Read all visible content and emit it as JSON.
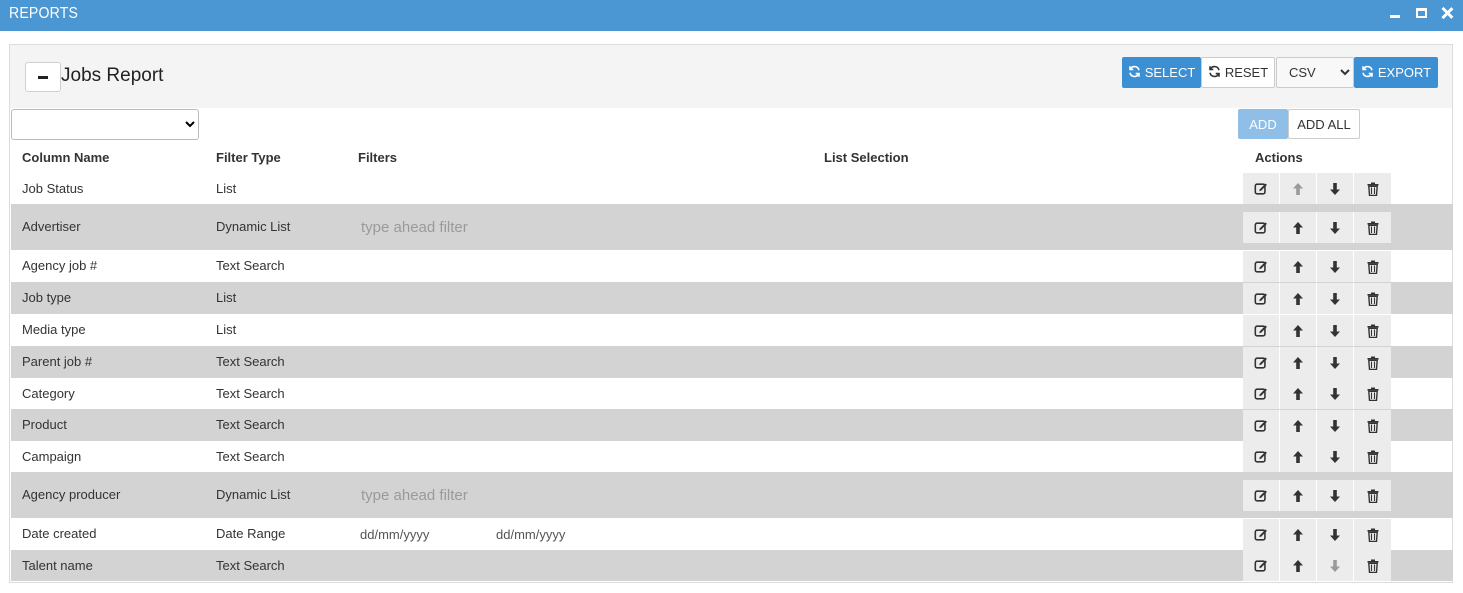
{
  "window": {
    "title": "REPORTS"
  },
  "report": {
    "title": "Jobs Report"
  },
  "toolbar": {
    "select_label": "SELECT",
    "reset_label": "RESET",
    "format_selected": "CSV",
    "format_options": [
      "CSV"
    ],
    "export_label": "EXPORT"
  },
  "columns_picker": {
    "selected": "",
    "add_label": "ADD",
    "add_all_label": "ADD ALL"
  },
  "table": {
    "headers": {
      "column_name": "Column Name",
      "filter_type": "Filter Type",
      "filters": "Filters",
      "list_selection": "List Selection",
      "actions": "Actions"
    },
    "rows": [
      {
        "column": "Job Status",
        "type": "List",
        "filter": "",
        "up_disabled": true,
        "down_disabled": false
      },
      {
        "column": "Advertiser",
        "type": "Dynamic List",
        "filter": "typeahead",
        "placeholder": "type ahead filter",
        "up_disabled": false,
        "down_disabled": false
      },
      {
        "column": "Agency job #",
        "type": "Text Search",
        "filter": "",
        "up_disabled": false,
        "down_disabled": false
      },
      {
        "column": "Job type",
        "type": "List",
        "filter": "",
        "up_disabled": false,
        "down_disabled": false
      },
      {
        "column": "Media type",
        "type": "List",
        "filter": "",
        "up_disabled": false,
        "down_disabled": false
      },
      {
        "column": "Parent job #",
        "type": "Text Search",
        "filter": "",
        "up_disabled": false,
        "down_disabled": false
      },
      {
        "column": "Category",
        "type": "Text Search",
        "filter": "",
        "up_disabled": false,
        "down_disabled": false
      },
      {
        "column": "Product",
        "type": "Text Search",
        "filter": "",
        "up_disabled": false,
        "down_disabled": false
      },
      {
        "column": "Campaign",
        "type": "Text Search",
        "filter": "",
        "up_disabled": false,
        "down_disabled": false
      },
      {
        "column": "Agency producer",
        "type": "Dynamic List",
        "filter": "typeahead",
        "placeholder": "type ahead filter",
        "up_disabled": false,
        "down_disabled": false
      },
      {
        "column": "Date created",
        "type": "Date Range",
        "filter": "daterange",
        "date_from_placeholder": "dd/mm/yyyy",
        "date_to_placeholder": "dd/mm/yyyy",
        "up_disabled": false,
        "down_disabled": false
      },
      {
        "column": "Talent name",
        "type": "Text Search",
        "filter": "",
        "up_disabled": false,
        "down_disabled": true
      }
    ]
  },
  "icons": {
    "edit": "edit-icon",
    "up": "arrow-up-icon",
    "down": "arrow-down-icon",
    "delete": "trash-icon",
    "refresh": "refresh-icon"
  },
  "colors": {
    "titlebar": "#4a97d3",
    "primary_button": "#3c8fd3",
    "disabled_button": "#8fbfe7",
    "shaded_row": "#d3d3d3",
    "action_button": "#ececec"
  }
}
